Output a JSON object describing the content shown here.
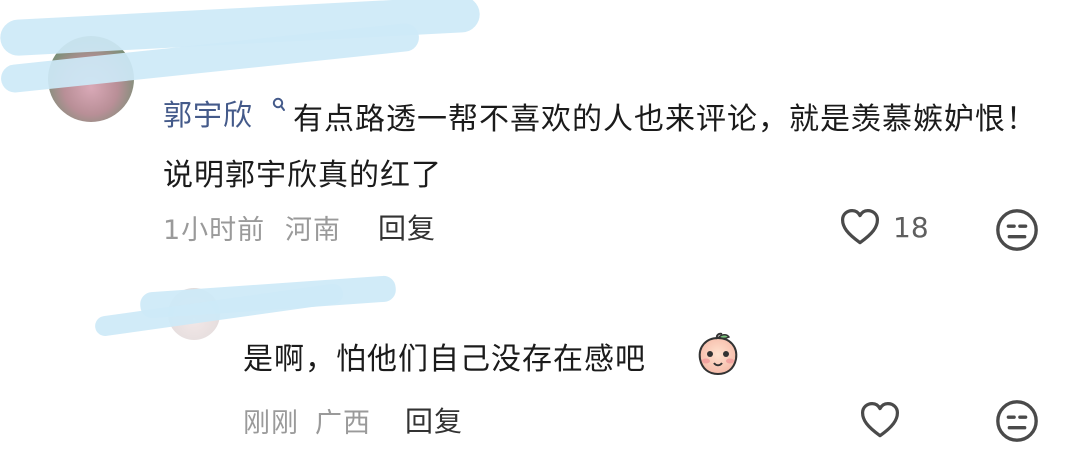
{
  "comment": {
    "username": "郭宇欣",
    "text": "有点路透一帮不喜欢的人也来评论，就是羡慕嫉妒恨！说明郭宇欣真的红了",
    "time": "1小时前",
    "location": "河南",
    "reply_label": "回复",
    "likes": "18"
  },
  "reply": {
    "text": "是啊，怕他们自己没存在感吧",
    "time": "刚刚",
    "location": "广西",
    "reply_label": "回复"
  },
  "icons": {
    "heart": "heart-icon",
    "dislike_face": "meh-face-icon",
    "emoji": "peach-emoji-icon",
    "user_badge": "user-badge-icon"
  },
  "colors": {
    "username": "#445a8a",
    "redaction": "#cde9f7",
    "meta_text": "#9a9a9a"
  }
}
